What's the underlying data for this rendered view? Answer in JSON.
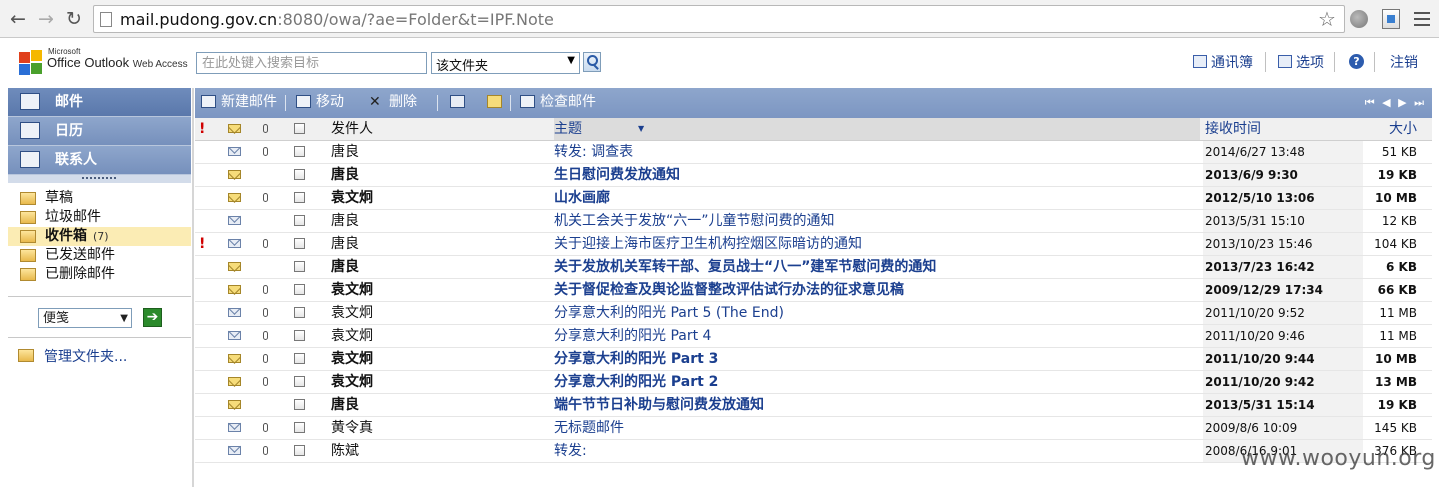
{
  "browser": {
    "url_host": "mail.pudong.gov.cn",
    "url_rest": ":8080/owa/?ae=Folder&t=IPF.Note"
  },
  "header": {
    "logo_small": "Microsoft",
    "logo_main": "Office Outlook",
    "logo_sub": "Web Access",
    "search_placeholder": "在此处键入搜索目标",
    "search_scope": "该文件夹",
    "links": {
      "address_book": "通讯簿",
      "options": "选项",
      "help": "?",
      "logout": "注销"
    }
  },
  "nav": {
    "mail": "邮件",
    "calendar": "日历",
    "contacts": "联系人"
  },
  "folders": [
    {
      "label": "草稿",
      "count": ""
    },
    {
      "label": "垃圾邮件",
      "count": ""
    },
    {
      "label": "收件箱",
      "count": "(7)"
    },
    {
      "label": "已发送邮件",
      "count": ""
    },
    {
      "label": "已删除邮件",
      "count": ""
    }
  ],
  "new_item_type": "便笺",
  "go_button": "➔",
  "manage_folders": "管理文件夹...",
  "toolbar": {
    "new_mail": "新建邮件",
    "move": "移动",
    "delete": "删除",
    "check_mail": "检查邮件",
    "pager": "⏮ ◀ ▶ ⏭"
  },
  "columns": {
    "importance": "!",
    "from": "发件人",
    "subject": "主题",
    "received": "接收时间",
    "size": "大小"
  },
  "messages": [
    {
      "important": "",
      "unread": false,
      "attach": true,
      "from": "唐良",
      "subject": "转发: 调查表",
      "received": "2014/6/27  13:48",
      "size": "51 KB"
    },
    {
      "important": "",
      "unread": true,
      "attach": false,
      "from": "唐良",
      "subject": "生日慰问费发放通知",
      "received": "2013/6/9  9:30",
      "size": "19 KB"
    },
    {
      "important": "",
      "unread": true,
      "attach": true,
      "from": "袁文炯",
      "subject": "山水画廊",
      "received": "2012/5/10  13:06",
      "size": "10 MB"
    },
    {
      "important": "",
      "unread": false,
      "attach": false,
      "from": "唐良",
      "subject": "机关工会关于发放“六一”儿童节慰问费的通知",
      "received": "2013/5/31  15:10",
      "size": "12 KB"
    },
    {
      "important": "!",
      "unread": false,
      "attach": true,
      "from": "唐良",
      "subject": "关于迎接上海市医疗卫生机构控烟区际暗访的通知",
      "received": "2013/10/23  15:46",
      "size": "104 KB"
    },
    {
      "important": "",
      "unread": true,
      "attach": false,
      "from": "唐良",
      "subject": "关于发放机关军转干部、复员战士“八一”建军节慰问费的通知",
      "received": "2013/7/23  16:42",
      "size": "6 KB"
    },
    {
      "important": "",
      "unread": true,
      "attach": true,
      "from": "袁文炯",
      "subject": "关于督促检查及舆论监督整改评估试行办法的征求意见稿",
      "received": "2009/12/29  17:34",
      "size": "66 KB"
    },
    {
      "important": "",
      "unread": false,
      "attach": true,
      "from": "袁文炯",
      "subject": "分享意大利的阳光 Part 5 (The End)",
      "received": "2011/10/20  9:52",
      "size": "11 MB"
    },
    {
      "important": "",
      "unread": false,
      "attach": true,
      "from": "袁文炯",
      "subject": "分享意大利的阳光 Part 4",
      "received": "2011/10/20  9:46",
      "size": "11 MB"
    },
    {
      "important": "",
      "unread": true,
      "attach": true,
      "from": "袁文炯",
      "subject": "分享意大利的阳光 Part 3",
      "received": "2011/10/20  9:44",
      "size": "10 MB"
    },
    {
      "important": "",
      "unread": true,
      "attach": true,
      "from": "袁文炯",
      "subject": "分享意大利的阳光 Part 2",
      "received": "2011/10/20  9:42",
      "size": "13 MB"
    },
    {
      "important": "",
      "unread": true,
      "attach": false,
      "from": "唐良",
      "subject": "端午节节日补助与慰问费发放通知",
      "received": "2013/5/31  15:14",
      "size": "19 KB"
    },
    {
      "important": "",
      "unread": false,
      "attach": true,
      "from": "黄令真",
      "subject": "无标题邮件",
      "received": "2009/8/6  10:09",
      "size": "145 KB"
    },
    {
      "important": "",
      "unread": false,
      "attach": true,
      "from": "陈斌",
      "subject": "转发:",
      "received": "2008/6/16  9:01",
      "size": "376 KB"
    }
  ],
  "watermark": "www.wooyun.org"
}
